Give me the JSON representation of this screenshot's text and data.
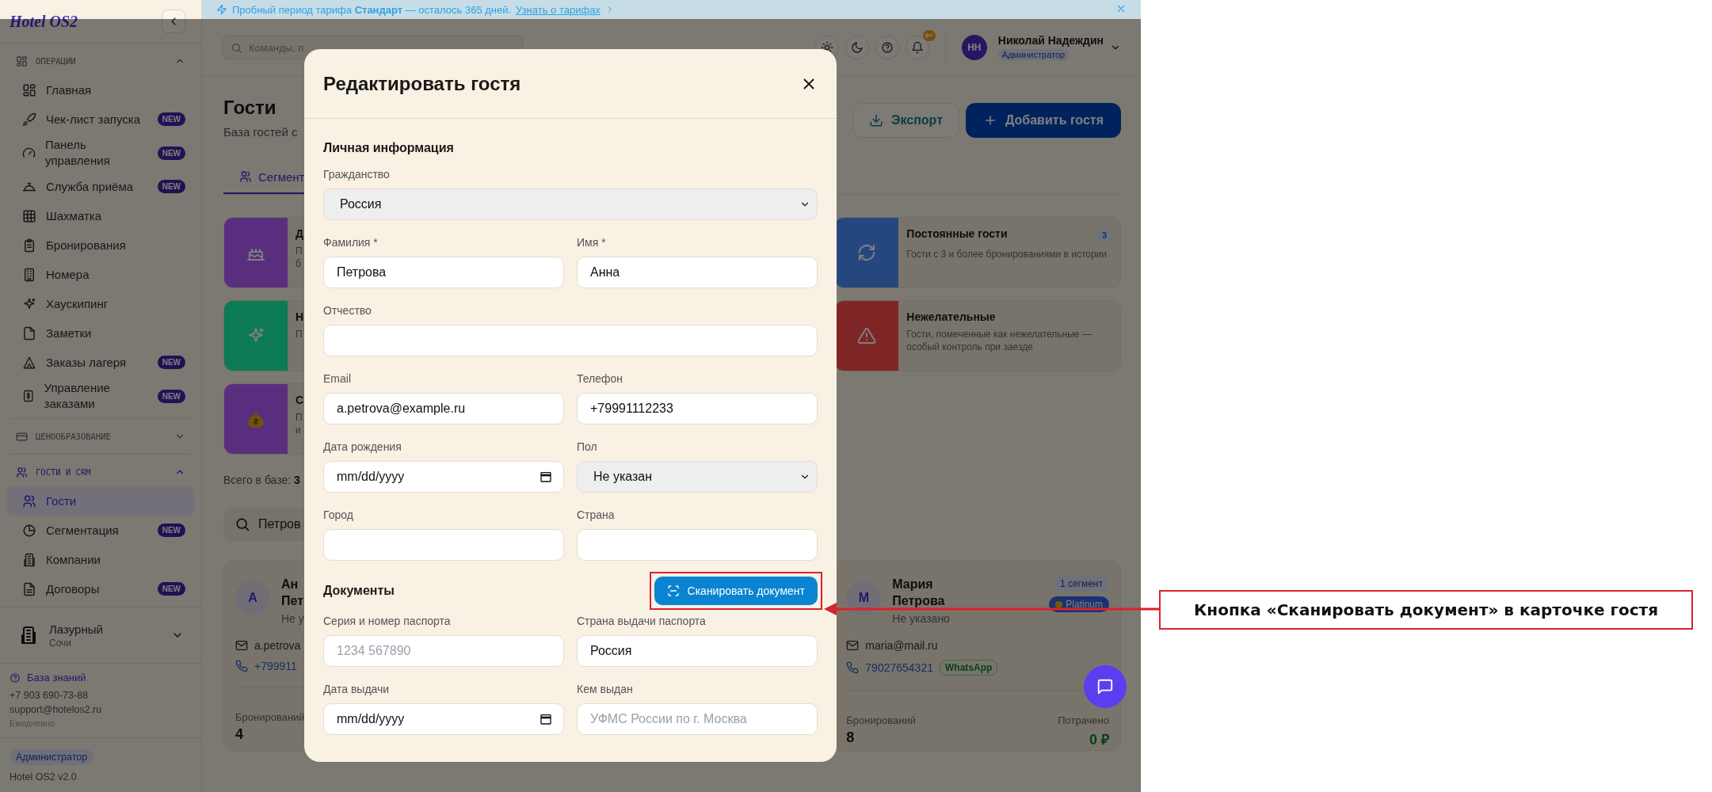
{
  "sidebar": {
    "logo": "Hotel OS2",
    "sections": [
      {
        "title": "ОПЕРАЦИИ",
        "expanded": true,
        "items": [
          {
            "label": "Главная",
            "selected": false
          },
          {
            "label": "Чек-лист запуска",
            "badge": "NEW",
            "selected": false
          },
          {
            "label": "Панель управления",
            "badge": "NEW",
            "selected": false
          },
          {
            "label": "Служба приёма",
            "badge": "NEW",
            "selected": false
          },
          {
            "label": "Шахматка",
            "selected": false
          },
          {
            "label": "Бронирования",
            "selected": false
          },
          {
            "label": "Номера",
            "selected": false
          },
          {
            "label": "Хаускипинг",
            "selected": false
          },
          {
            "label": "Заметки",
            "selected": false
          },
          {
            "label": "Заказы лагеря",
            "badge": "NEW",
            "selected": false
          },
          {
            "label": "Управление заказами",
            "badge": "NEW",
            "selected": false
          }
        ]
      },
      {
        "title": "ЦЕНООБРАЗОВАНИЕ",
        "expanded": false
      },
      {
        "title": "ГОСТИ И CRM",
        "expanded": true,
        "items": [
          {
            "label": "Гости",
            "selected": true
          },
          {
            "label": "Сегментация",
            "badge": "NEW",
            "selected": false
          },
          {
            "label": "Компании",
            "selected": false
          },
          {
            "label": "Договоры",
            "badge": "NEW",
            "selected": false
          }
        ]
      }
    ],
    "property": {
      "name": "Лазурный",
      "city": "Сочи"
    },
    "support": {
      "link": "База знаний",
      "phone": "+7 903 690-73-88",
      "email": "support@hotelos2.ru",
      "hours": "Ежедневно"
    },
    "role": "Администратор",
    "version": "Hotel OS2 v2.0"
  },
  "banner": {
    "text": "Пробный период тарифа **Стандарт** — осталось 365 дней.",
    "link": "Узнать о тарифах"
  },
  "topbar": {
    "search": {
      "placeholder": "Команды, п"
    },
    "notifications": "9+",
    "user": {
      "initials": "НН",
      "name": "Николай Надеждин",
      "role": "Администратор"
    }
  },
  "page": {
    "title": "Гости",
    "subtitle": "База гостей с",
    "actions": [
      {
        "label": "Экспорт",
        "kind": "secondary"
      },
      {
        "label": "Добавить гостя",
        "kind": "primary"
      }
    ]
  },
  "tabs": [
    {
      "label": "Сегмент",
      "selected": true
    }
  ],
  "segments": [
    {
      "title": "Д",
      "description": "П б",
      "color": "#5a2e7e"
    },
    {
      "title": "Постоянные гости",
      "description": "Гости с 3 и более бронированиями в истории",
      "count": "3",
      "color": "#24487e"
    },
    {
      "title": "Н",
      "description": "П",
      "color": "#0c7a55"
    },
    {
      "title": "Нежелательные",
      "description": "Гости, помеченные как нежелательные — особый контроль при заезде",
      "color": "#7e2626"
    },
    {
      "title": "С",
      "description": "П и",
      "color": "#5a2e7e"
    }
  ],
  "summary": "Всего в базе: **3**",
  "guest_search": {
    "value": "Петров"
  },
  "guests": [
    {
      "initials": "А",
      "name": "Ан Пет",
      "gender": "Не у",
      "email": "a.petrova",
      "phone": "+799911",
      "stats": [
        {
          "label": "Бронирований",
          "value": "4"
        }
      ]
    },
    {
      "initials": "М",
      "name": "Мария Петрова",
      "gender": "Не указано",
      "segments": "1 сегмент",
      "tier": "Platinum",
      "email": "maria@mail.ru",
      "phone": "79027654321",
      "messenger": "WhatsApp",
      "stats": [
        {
          "label": "Бронирований",
          "value": "8"
        },
        {
          "label": "Потрачено",
          "value": "0 ₽"
        }
      ]
    }
  ],
  "modal": {
    "title": "Редактировать гостя",
    "sections": [
      {
        "title": "Личная информация",
        "rows": [
          [
            {
              "label": "Гражданство",
              "kind": "select",
              "value": "Россия"
            }
          ],
          [
            {
              "label": "Фамилия *",
              "kind": "text",
              "value": "Петрова"
            },
            {
              "label": "Имя *",
              "kind": "text",
              "value": "Анна"
            }
          ],
          [
            {
              "label": "Отчество",
              "kind": "text"
            }
          ],
          [
            {
              "label": "Email",
              "kind": "text",
              "value": "a.petrova@example.ru"
            },
            {
              "label": "Телефон",
              "kind": "text",
              "value": "+79991112233"
            }
          ],
          [
            {
              "label": "Дата рождения",
              "kind": "date",
              "value": "mm/dd/yyyy"
            },
            {
              "label": "Пол",
              "kind": "select",
              "value": "Не указан"
            }
          ],
          [
            {
              "label": "Город",
              "kind": "text"
            },
            {
              "label": "Страна",
              "kind": "text"
            }
          ]
        ]
      },
      {
        "title": "Документы",
        "action": "Сканировать документ",
        "rows": [
          [
            {
              "label": "Серия и номер паспорта",
              "kind": "text",
              "placeholder": "1234 567890"
            },
            {
              "label": "Страна выдачи паспорта",
              "kind": "text",
              "value": "Россия"
            }
          ],
          [
            {
              "label": "Дата выдачи",
              "kind": "date",
              "value": "mm/dd/yyyy"
            },
            {
              "label": "Кем выдан",
              "kind": "text",
              "placeholder": "УФМС России по г. Москва"
            }
          ]
        ]
      }
    ]
  },
  "annotation": {
    "text": "Кнопка «Сканировать документ» в карточке гостя"
  }
}
